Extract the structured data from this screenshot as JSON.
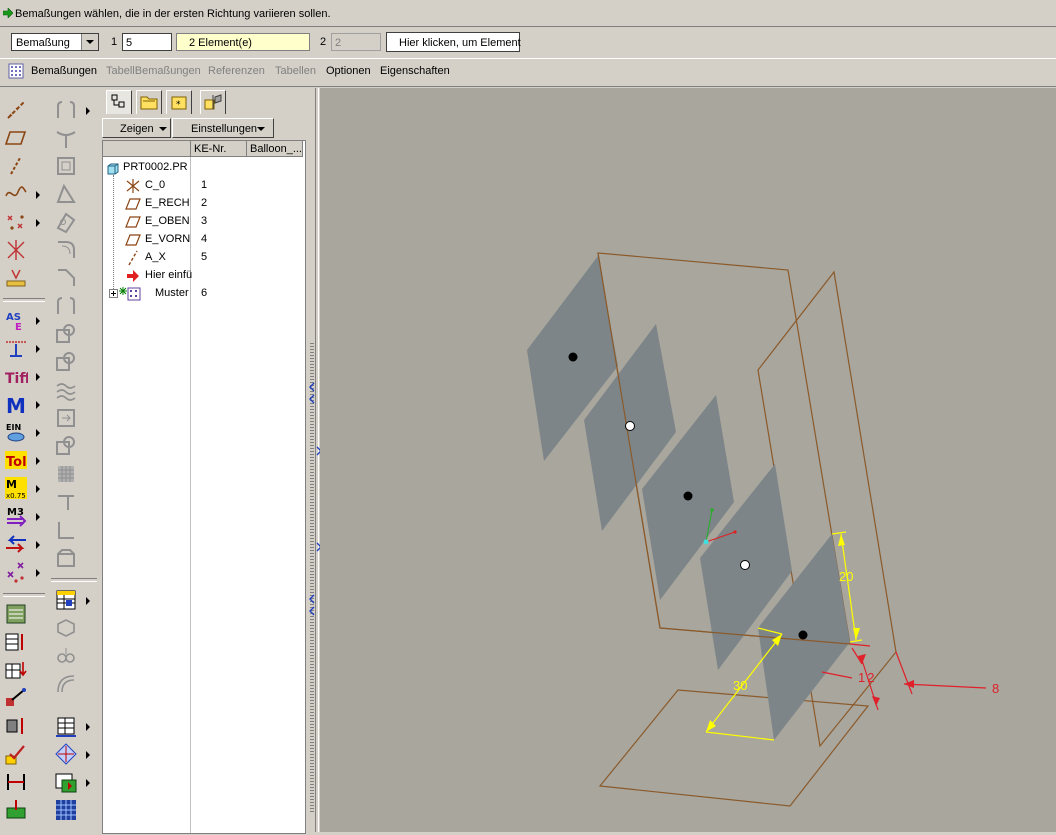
{
  "message": "Bemaßungen wählen, die in der ersten Richtung variieren sollen.",
  "dashboard": {
    "pattern_type": "Bemaßung",
    "dir1_label": "1",
    "dir1_count": "5",
    "dir1_elements": "2 Element(e)",
    "dir2_label": "2",
    "dir2_count": "2",
    "dir2_button": "Hier klicken, um Element"
  },
  "tabs": [
    "Bemaßungen",
    "TabellBemaßungen",
    "Referenzen",
    "Tabellen",
    "Optionen",
    "Eigenschaften"
  ],
  "tabs_disabled": [
    false,
    true,
    true,
    true,
    false,
    false
  ],
  "tree_panel": {
    "show_label": "Zeigen",
    "settings_label": "Einstellungen",
    "columns": [
      "KE-Nr.",
      "Balloon_..."
    ],
    "root": "PRT0002.PR",
    "items": [
      {
        "name": "C_0",
        "id": "1",
        "icon": "csys-icon"
      },
      {
        "name": "E_RECH",
        "id": "2",
        "icon": "datum-plane-icon"
      },
      {
        "name": "E_OBEN",
        "id": "3",
        "icon": "datum-plane-icon"
      },
      {
        "name": "E_VORN",
        "id": "4",
        "icon": "datum-plane-icon"
      },
      {
        "name": "A_X",
        "id": "5",
        "icon": "datum-axis-icon"
      },
      {
        "name": "Hier einfü",
        "id": "",
        "icon": "insert-here-arrow-icon"
      },
      {
        "name": "Muster",
        "id": "6",
        "icon": "pattern-icon"
      }
    ]
  },
  "viewport": {
    "dimensions": [
      "20",
      "30",
      "12",
      "8"
    ],
    "background_color": "#a8a69d",
    "plane_color": "#7d8588",
    "outline_color": "#8b5a2b",
    "dimension_color": "#ffff00",
    "dim_red": "#e0202a"
  }
}
